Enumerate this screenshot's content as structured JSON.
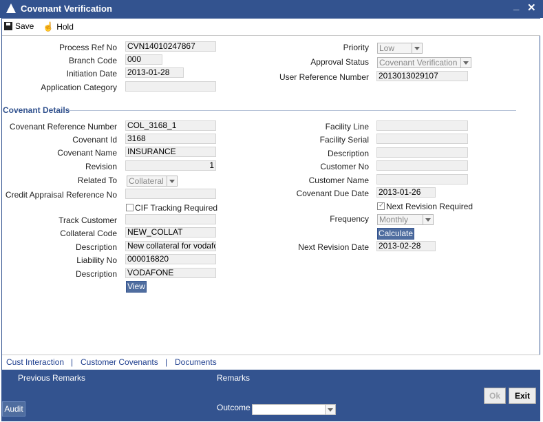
{
  "window": {
    "title": "Covenant Verification",
    "minimize": "_",
    "close": "✕"
  },
  "toolbar": {
    "save_label": "Save",
    "hold_label": "Hold"
  },
  "header": {
    "process_ref_label": "Process Ref No",
    "process_ref_value": "CVN14010247867",
    "branch_code_label": "Branch Code",
    "branch_code_value": "000",
    "initiation_date_label": "Initiation Date",
    "initiation_date_value": "2013-01-28",
    "application_category_label": "Application Category",
    "application_category_value": "",
    "priority_label": "Priority",
    "priority_value": "Low",
    "approval_status_label": "Approval Status",
    "approval_status_value": "Covenant Verification",
    "user_ref_label": "User Reference Number",
    "user_ref_value": "2013013029107"
  },
  "covenant": {
    "section_title": "Covenant Details",
    "ref_no_label": "Covenant Reference Number",
    "ref_no_value": "COL_3168_1",
    "id_label": "Covenant Id",
    "id_value": "3168",
    "name_label": "Covenant Name",
    "name_value": "INSURANCE",
    "revision_label": "Revision",
    "revision_value": "1",
    "related_to_label": "Related To",
    "related_to_value": "Collateral",
    "credit_appraisal_label": "Credit Appraisal Reference No",
    "credit_appraisal_value": "",
    "cif_tracking_label": "CIF Tracking Required",
    "track_customer_label": "Track Customer",
    "track_customer_value": "",
    "collateral_code_label": "Collateral Code",
    "collateral_code_value": "NEW_COLLAT",
    "description1_label": "Description",
    "description1_value": "New collateral for vodafo",
    "liability_no_label": "Liability No",
    "liability_no_value": "000016820",
    "description2_label": "Description",
    "description2_value": "VODAFONE",
    "view_label": "View",
    "facility_line_label": "Facility Line",
    "facility_line_value": "",
    "facility_serial_label": "Facility Serial",
    "facility_serial_value": "",
    "description_r_label": "Description",
    "description_r_value": "",
    "customer_no_label": "Customer No",
    "customer_no_value": "",
    "customer_name_label": "Customer Name",
    "customer_name_value": "",
    "due_date_label": "Covenant Due Date",
    "due_date_value": "2013-01-26",
    "next_revision_required_label": "Next Revision Required",
    "frequency_label": "Frequency",
    "frequency_value": "Monthly",
    "calculate_label": "Calculate",
    "next_revision_date_label": "Next Revision Date",
    "next_revision_date_value": "2013-02-28"
  },
  "links": {
    "cust_interaction": "Cust Interaction",
    "customer_covenants": "Customer Covenants",
    "documents": "Documents",
    "separator": "|"
  },
  "footer": {
    "previous_remarks": "Previous Remarks",
    "remarks": "Remarks",
    "outcome_label": "Outcome",
    "outcome_value": "",
    "audit_label": "Audit",
    "ok_label": "Ok",
    "exit_label": "Exit"
  }
}
